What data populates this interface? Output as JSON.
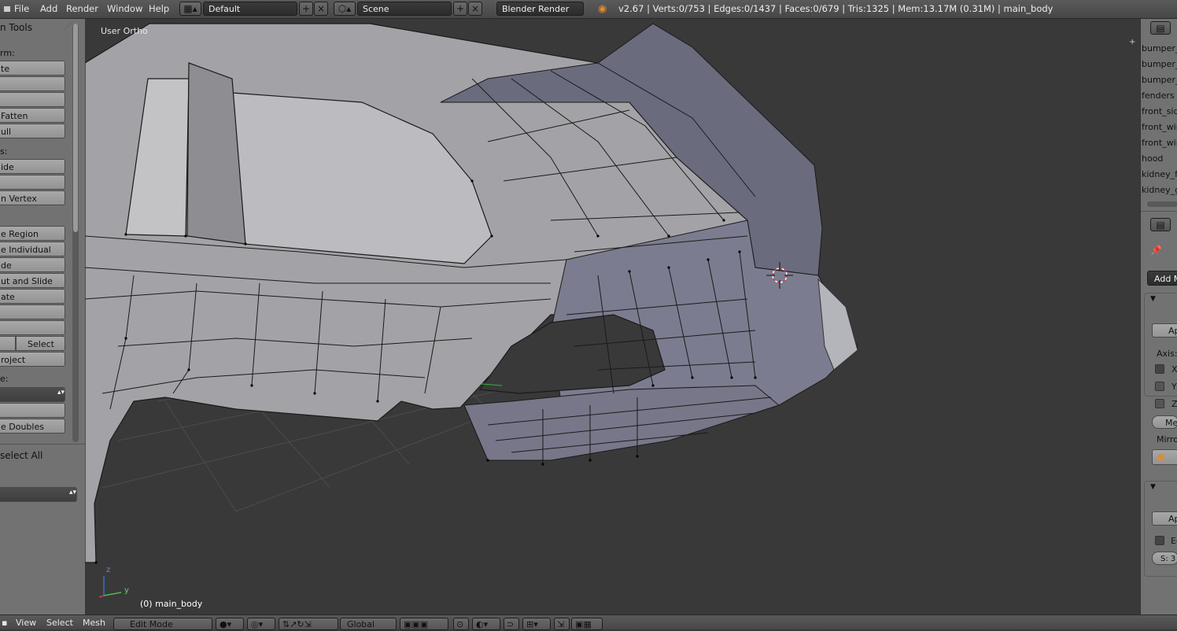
{
  "menu": {
    "file": "File",
    "add": "Add",
    "render": "Render",
    "window": "Window",
    "help": "Help"
  },
  "screen_layout": "Default",
  "scene": "Scene",
  "render_engine": "Blender Render",
  "stats": "v2.67 | Verts:0/753 | Edges:0/1437 | Faces:0/679 | Tris:1325 | Mem:13.17M (0.31M) | main_body",
  "toolshelf": {
    "title": "n Tools",
    "transform_label": "rm:",
    "buttons": [
      "te",
      "",
      "",
      "Fatten",
      "ull"
    ],
    "deform_label": "s:",
    "buttons2": [
      "ide",
      "",
      "n Vertex"
    ],
    "buttons3": [
      "e Region",
      "e Individual",
      "de",
      "ut and Slide",
      "ate",
      "",
      ""
    ],
    "select_left": "",
    "select_right": "Select",
    "project": "roject",
    "remove_label": "e:",
    "buttons4": [
      "",
      ""
    ],
    "remove_doubles": "e Doubles",
    "deselect_all": "select All"
  },
  "viewport": {
    "view_label": "User Ortho",
    "object_label": "(0) main_body",
    "axis_z": "z",
    "axis_y": "y"
  },
  "outliner": {
    "items": [
      "bumper_l",
      "bumper_r",
      "bumper_s",
      "fenders",
      "front_side",
      "front_win",
      "front_win",
      "hood",
      "kidney_fra",
      "kidney_gr"
    ]
  },
  "properties": {
    "add_modifier": "Add M",
    "apply1": "Ap",
    "axis_label": "Axis:",
    "x": "X",
    "y": "Y",
    "z": "Z",
    "merge": "Me",
    "mirror_label": "Mirro",
    "apply2": "Ap",
    "edge": "Ec",
    "subdiv": "S: 3"
  },
  "bottom": {
    "view": "View",
    "select": "Select",
    "mesh": "Mesh",
    "mode": "Edit Mode",
    "orientation": "Global"
  }
}
